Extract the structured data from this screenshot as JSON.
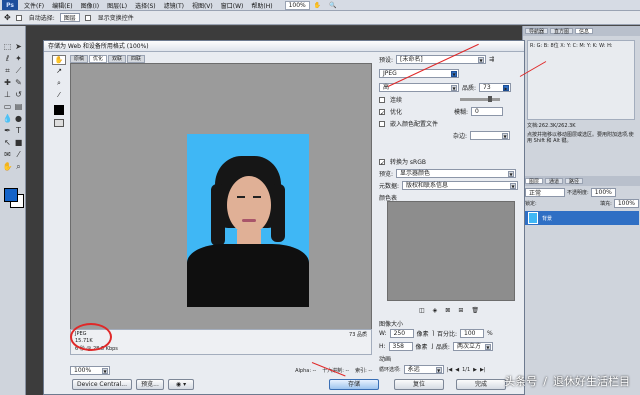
{
  "menu": {
    "logo": "Ps",
    "items": [
      "文件(F)",
      "编辑(E)",
      "图像(I)",
      "图层(L)",
      "选择(S)",
      "滤镜(T)",
      "视图(V)",
      "窗口(W)",
      "帮助(H)"
    ],
    "zoom": "100%"
  },
  "options": {
    "auto_select_label": "自动选择:",
    "auto_select_value": "图层",
    "transform_label": "显示变换控件"
  },
  "dialog": {
    "title": "存储为 Web 和设备所用格式 (100%)",
    "preview_tabs": [
      "原稿",
      "优化",
      "双联",
      "四联"
    ],
    "active_preview_tab": "优化",
    "info_format": "JPEG",
    "info_size": "15.71K",
    "info_speed": "6 秒 @ 28.8 Kbps",
    "info_quality": "73 品质",
    "zoom": "100%",
    "status_alpha": "Alpha: --",
    "status_hex": "十六进制: --",
    "status_index": "索引: --",
    "device_central": "Device Central...",
    "preview_btn": "预览...",
    "save_btn": "存储",
    "reset_btn": "复位",
    "done_btn": "完成"
  },
  "settings": {
    "preset_label": "预设:",
    "preset_value": "[未命名]",
    "format": "JPEG",
    "compression": "高",
    "quality_label": "品质:",
    "quality_value": "73",
    "progressive_label": "连续",
    "optimized_label": "优化",
    "blur_label": "模糊:",
    "blur_value": "0",
    "embed_profile_label": "嵌入颜色配置文件",
    "matte_label": "杂边:",
    "convert_srgb_label": "转换为 sRGB",
    "preview_label": "预览:",
    "preview_value": "显示器颜色",
    "metadata_label": "元数据:",
    "metadata_value": "版权和联系信息",
    "color_table_label": "颜色表",
    "image_size_label": "图像大小",
    "width_label": "W:",
    "width_value": "250",
    "height_label": "H:",
    "height_value": "358",
    "pixels": "像素",
    "percent_label": "百分比:",
    "percent_value": "100",
    "percent_unit": "%",
    "quality2_label": "品质:",
    "quality2_value": "两次立方",
    "animation_label": "动画",
    "loop_label": "循环选项:",
    "loop_value": "永远",
    "frame_counter": "1/1"
  },
  "right_panel": {
    "tabs_top": [
      "导航器",
      "直方图",
      "信息"
    ],
    "info_text": "R: G: B: 8位 X: Y: C: M: Y: K: W: H:",
    "doc_info": "文档:262.3K/262.3K",
    "hint": "点按并拖移以移动图层或选区。要用附加选项,使用 Shift 和 Alt 键。",
    "tabs_layers": [
      "图层",
      "通道",
      "路径"
    ],
    "blend_mode": "正常",
    "opacity_label": "不透明度:",
    "opacity": "100%",
    "lock_label": "锁定:",
    "fill_label": "填充:",
    "fill": "100%",
    "layer_name": "背景"
  },
  "watermark": {
    "source": "头条号",
    "separator": "/",
    "author": "退休好生活栏目"
  },
  "colors": {
    "photo_bg": "#3fb7f5",
    "annotation": "#e02828",
    "accent": "#1463c8"
  }
}
